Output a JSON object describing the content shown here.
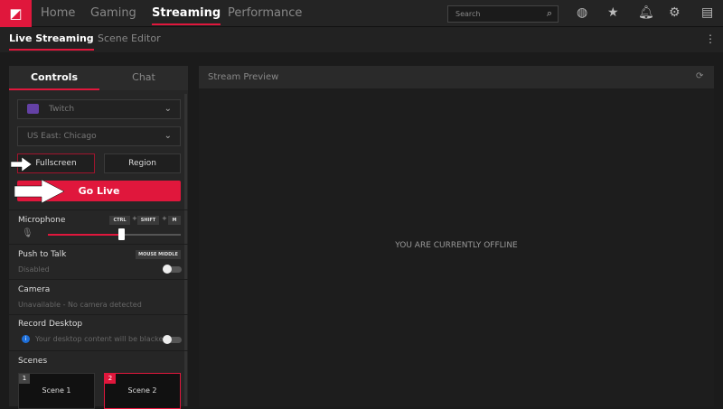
{
  "topnav": {
    "items": [
      "Home",
      "Gaming",
      "Streaming",
      "Performance"
    ],
    "active": "Streaming",
    "search_placeholder": "Search"
  },
  "subnav": {
    "items": [
      "Live Streaming",
      "Scene Editor"
    ],
    "active": "Live Streaming"
  },
  "panel": {
    "tabs": [
      "Controls",
      "Chat"
    ],
    "platform": "Twitch",
    "server": "US East: Chicago",
    "capture_modes": [
      "Fullscreen",
      "Region"
    ],
    "go_live": "Go Live",
    "microphone": {
      "label": "Microphone",
      "hotkeys": [
        "CTRL",
        "SHIFT",
        "M"
      ],
      "separator": "+",
      "volume_percent": 55
    },
    "push_to_talk": {
      "label": "Push to Talk",
      "hotkey": "MOUSE MIDDLE",
      "status": "Disabled"
    },
    "camera": {
      "label": "Camera",
      "status": "Unavailable - No camera detected"
    },
    "record_desktop": {
      "label": "Record Desktop",
      "info": "Your desktop content will be blacked..."
    },
    "scenes": {
      "label": "Scenes",
      "items": [
        {
          "num": "1",
          "name": "Scene 1"
        },
        {
          "num": "2",
          "name": "Scene 2"
        }
      ]
    }
  },
  "preview": {
    "title": "Stream Preview",
    "status": "YOU ARE CURRENTLY OFFLINE"
  },
  "colors": {
    "accent": "#e0173c"
  }
}
